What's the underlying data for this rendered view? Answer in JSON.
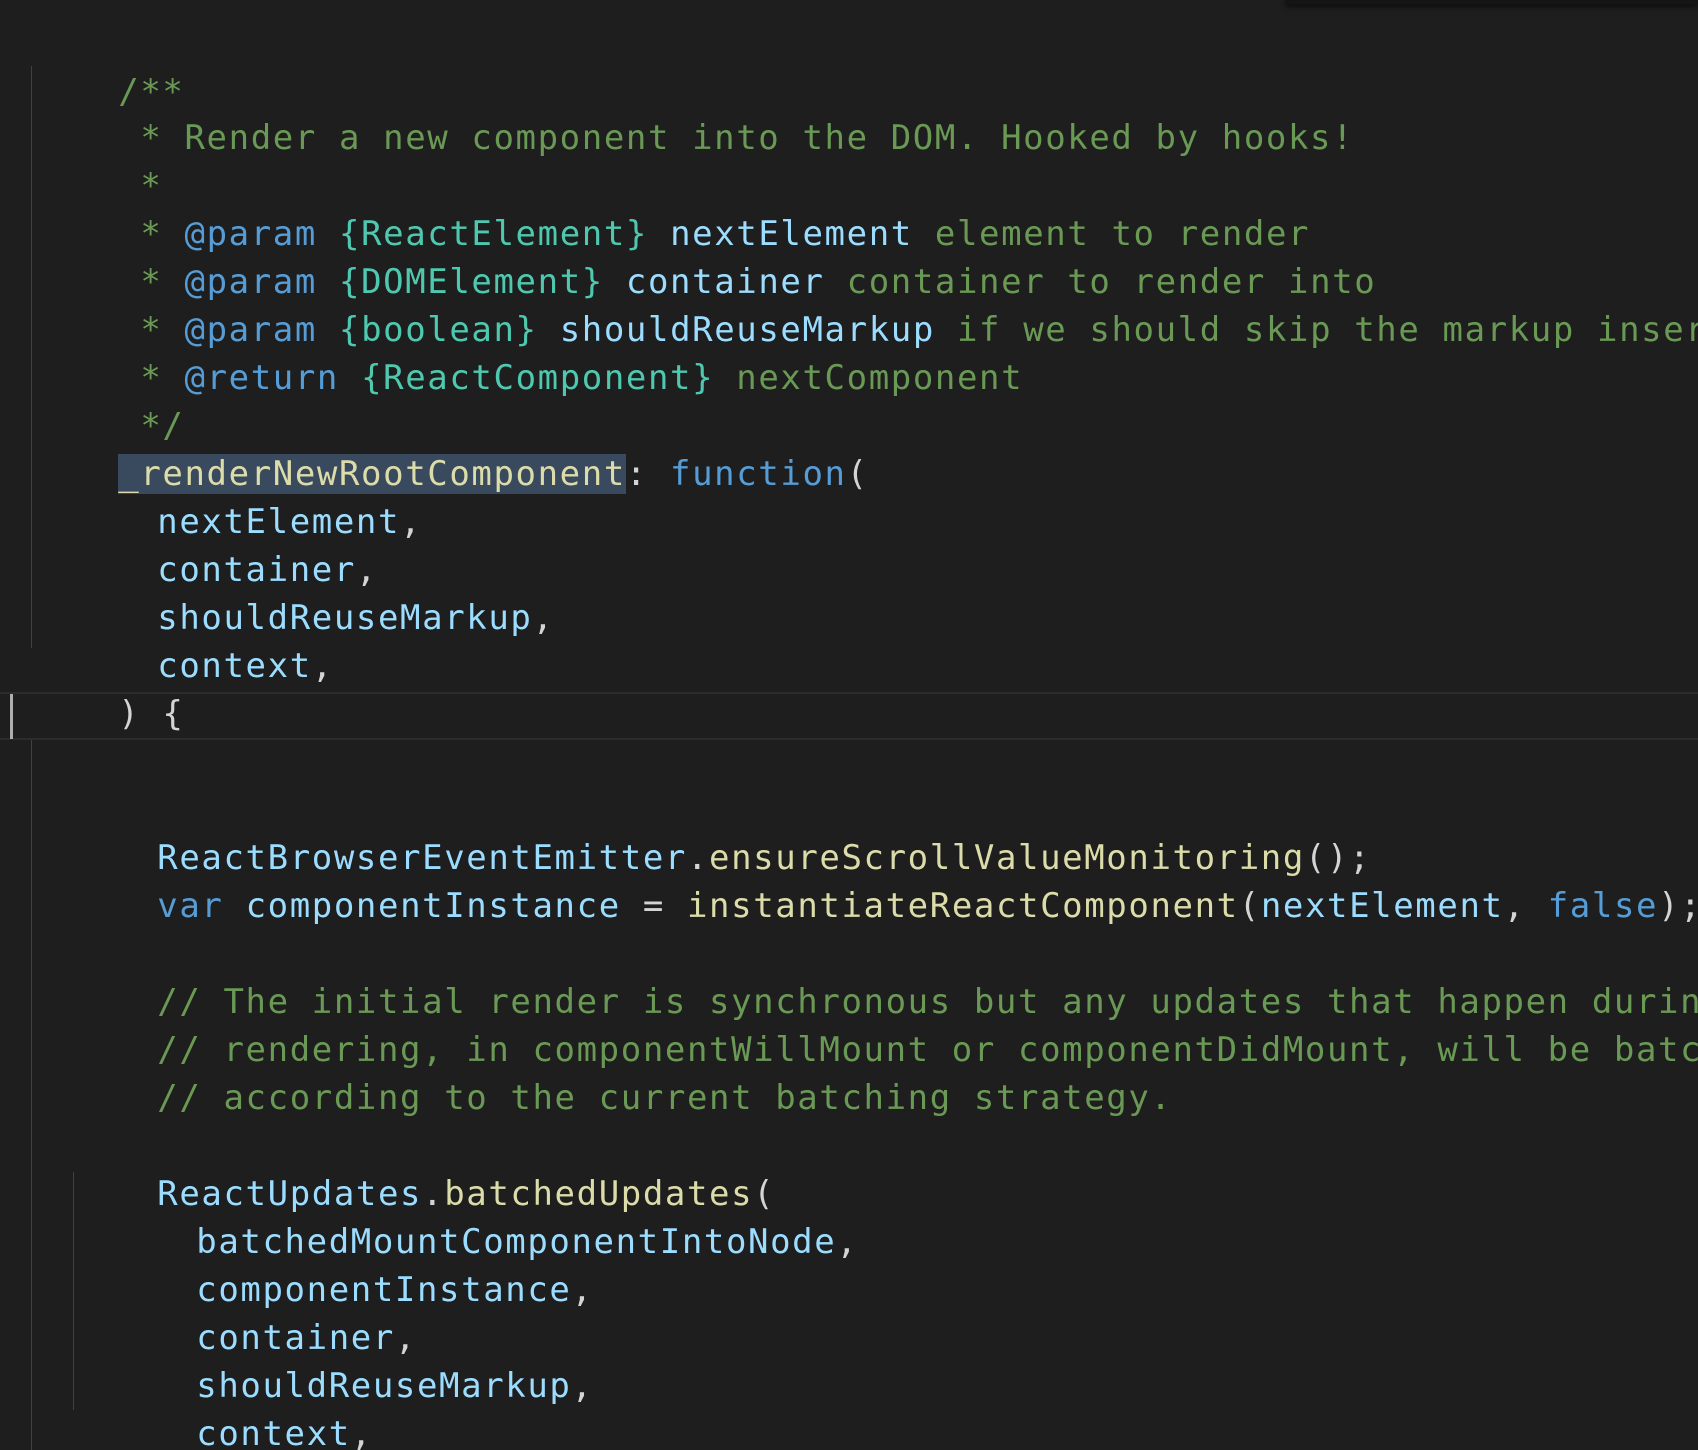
{
  "doc": {
    "l1": "/**",
    "l2": " * Render a new component into the DOM. Hooked by hooks!",
    "l3": " *",
    "l4": {
      "star": " * ",
      "tag": "@param",
      "type": "{ReactElement}",
      "name": "nextElement",
      "desc": "element to render"
    },
    "l5": {
      "star": " * ",
      "tag": "@param",
      "type": "{DOMElement}",
      "name": "container",
      "desc": "container to render into"
    },
    "l6": {
      "star": " * ",
      "tag": "@param",
      "type": "{boolean}",
      "name": "shouldReuseMarkup",
      "desc": "if we should skip the markup insertion"
    },
    "l7": {
      "star": " * ",
      "tag": "@return",
      "type": "{ReactComponent}",
      "desc": "nextComponent"
    },
    "l8": " */"
  },
  "code": {
    "fn_name": "_renderNewRootComponent",
    "colon": ": ",
    "fn_kw": "function",
    "open_paren": "(",
    "params": [
      "nextElement",
      "container",
      "shouldReuseMarkup",
      "context"
    ],
    "close": ") {",
    "emitter": {
      "obj": "ReactBrowserEventEmitter",
      "dot": ".",
      "method": "ensureScrollValueMonitoring",
      "tail": "();"
    },
    "var_line": {
      "kw": "var",
      "name": "componentInstance",
      "eq": " = ",
      "fn": "instantiateReactComponent",
      "open": "(",
      "arg": "nextElement",
      "comma": ", ",
      "bool": "false",
      "tail": ");"
    },
    "comments": [
      "// The initial render is synchronous but any updates that happen during",
      "// rendering, in componentWillMount or componentDidMount, will be batched",
      "// according to the current batching strategy."
    ],
    "batched": {
      "obj": "ReactUpdates",
      "dot": ".",
      "method": "batchedUpdates",
      "open": "(",
      "args": [
        "batchedMountComponentIntoNode",
        "componentInstance",
        "container",
        "shouldReuseMarkup",
        "context"
      ],
      "close": ");"
    },
    "comma": ","
  }
}
